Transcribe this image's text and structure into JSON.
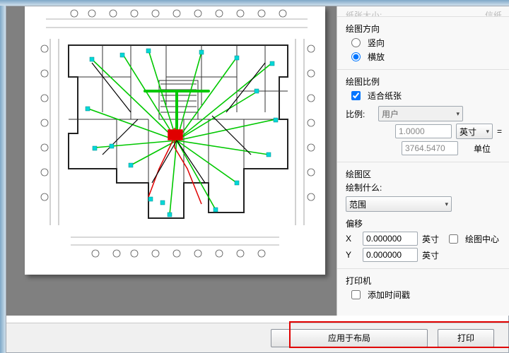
{
  "topRight": {
    "cutFieldLeft": "纸张大小:",
    "cutFieldRight": "信纸"
  },
  "orientation": {
    "title": "绘图方向",
    "portrait": "竖向",
    "landscape": "横放",
    "value": "landscape"
  },
  "scaleGroup": {
    "title": "绘图比例",
    "fitPaper": "适合纸张",
    "fitPaperChecked": true,
    "ratioLabel": "比例:",
    "ratioValue": "用户",
    "num1": "1.0000",
    "unit1": "英寸",
    "num2": "3764.5470",
    "unit2": "单位"
  },
  "areaGroup": {
    "title": "绘图区",
    "whatLabel": "绘制什么:",
    "whatValue": "范围",
    "offsetLabel": "偏移",
    "x": "X",
    "y": "Y",
    "xVal": "0.000000",
    "yVal": "0.000000",
    "unit": "英寸",
    "center": "绘图中心",
    "centerChecked": false
  },
  "printer": {
    "title": "打印机",
    "timestamp": "添加时间戳",
    "timestampChecked": false
  },
  "footer": {
    "applyLayout": "应用于布局",
    "print": "打印"
  },
  "icons": {
    "dd": "▾",
    "eq": "="
  }
}
